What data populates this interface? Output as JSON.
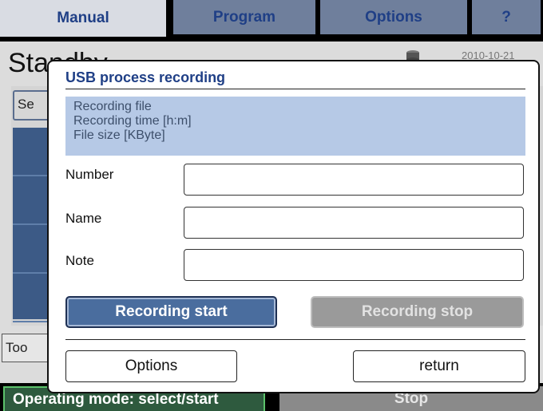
{
  "tabs": [
    {
      "label": "Manual",
      "active": true
    },
    {
      "label": "Program",
      "active": false
    },
    {
      "label": "Options",
      "active": false
    },
    {
      "label": "?",
      "active": false
    }
  ],
  "background": {
    "title": "Standby",
    "date": "2010-10-21",
    "side_button_label": "Se",
    "tool_button_label": "Too"
  },
  "status": {
    "mode_text": "Operating mode: select/start",
    "stop_label": "Stop"
  },
  "dialog": {
    "title": "USB process recording",
    "info_lines": [
      "Recording file",
      "Recording time [h:m]",
      "File size [KByte]"
    ],
    "fields": [
      {
        "label": "Number",
        "value": ""
      },
      {
        "label": "Name",
        "value": ""
      },
      {
        "label": "Note",
        "value": ""
      }
    ],
    "recording_start_label": "Recording start",
    "recording_stop_label": "Recording stop",
    "options_label": "Options",
    "return_label": "return"
  },
  "colors": {
    "tab_text": "#1f3f86",
    "tab_inactive": "#6f7f9c",
    "info_box": "#b6c9e6",
    "primary_button": "#4a6d9e",
    "disabled_button": "#9a9a9a",
    "mode_indicator": "#2e5a3e"
  }
}
